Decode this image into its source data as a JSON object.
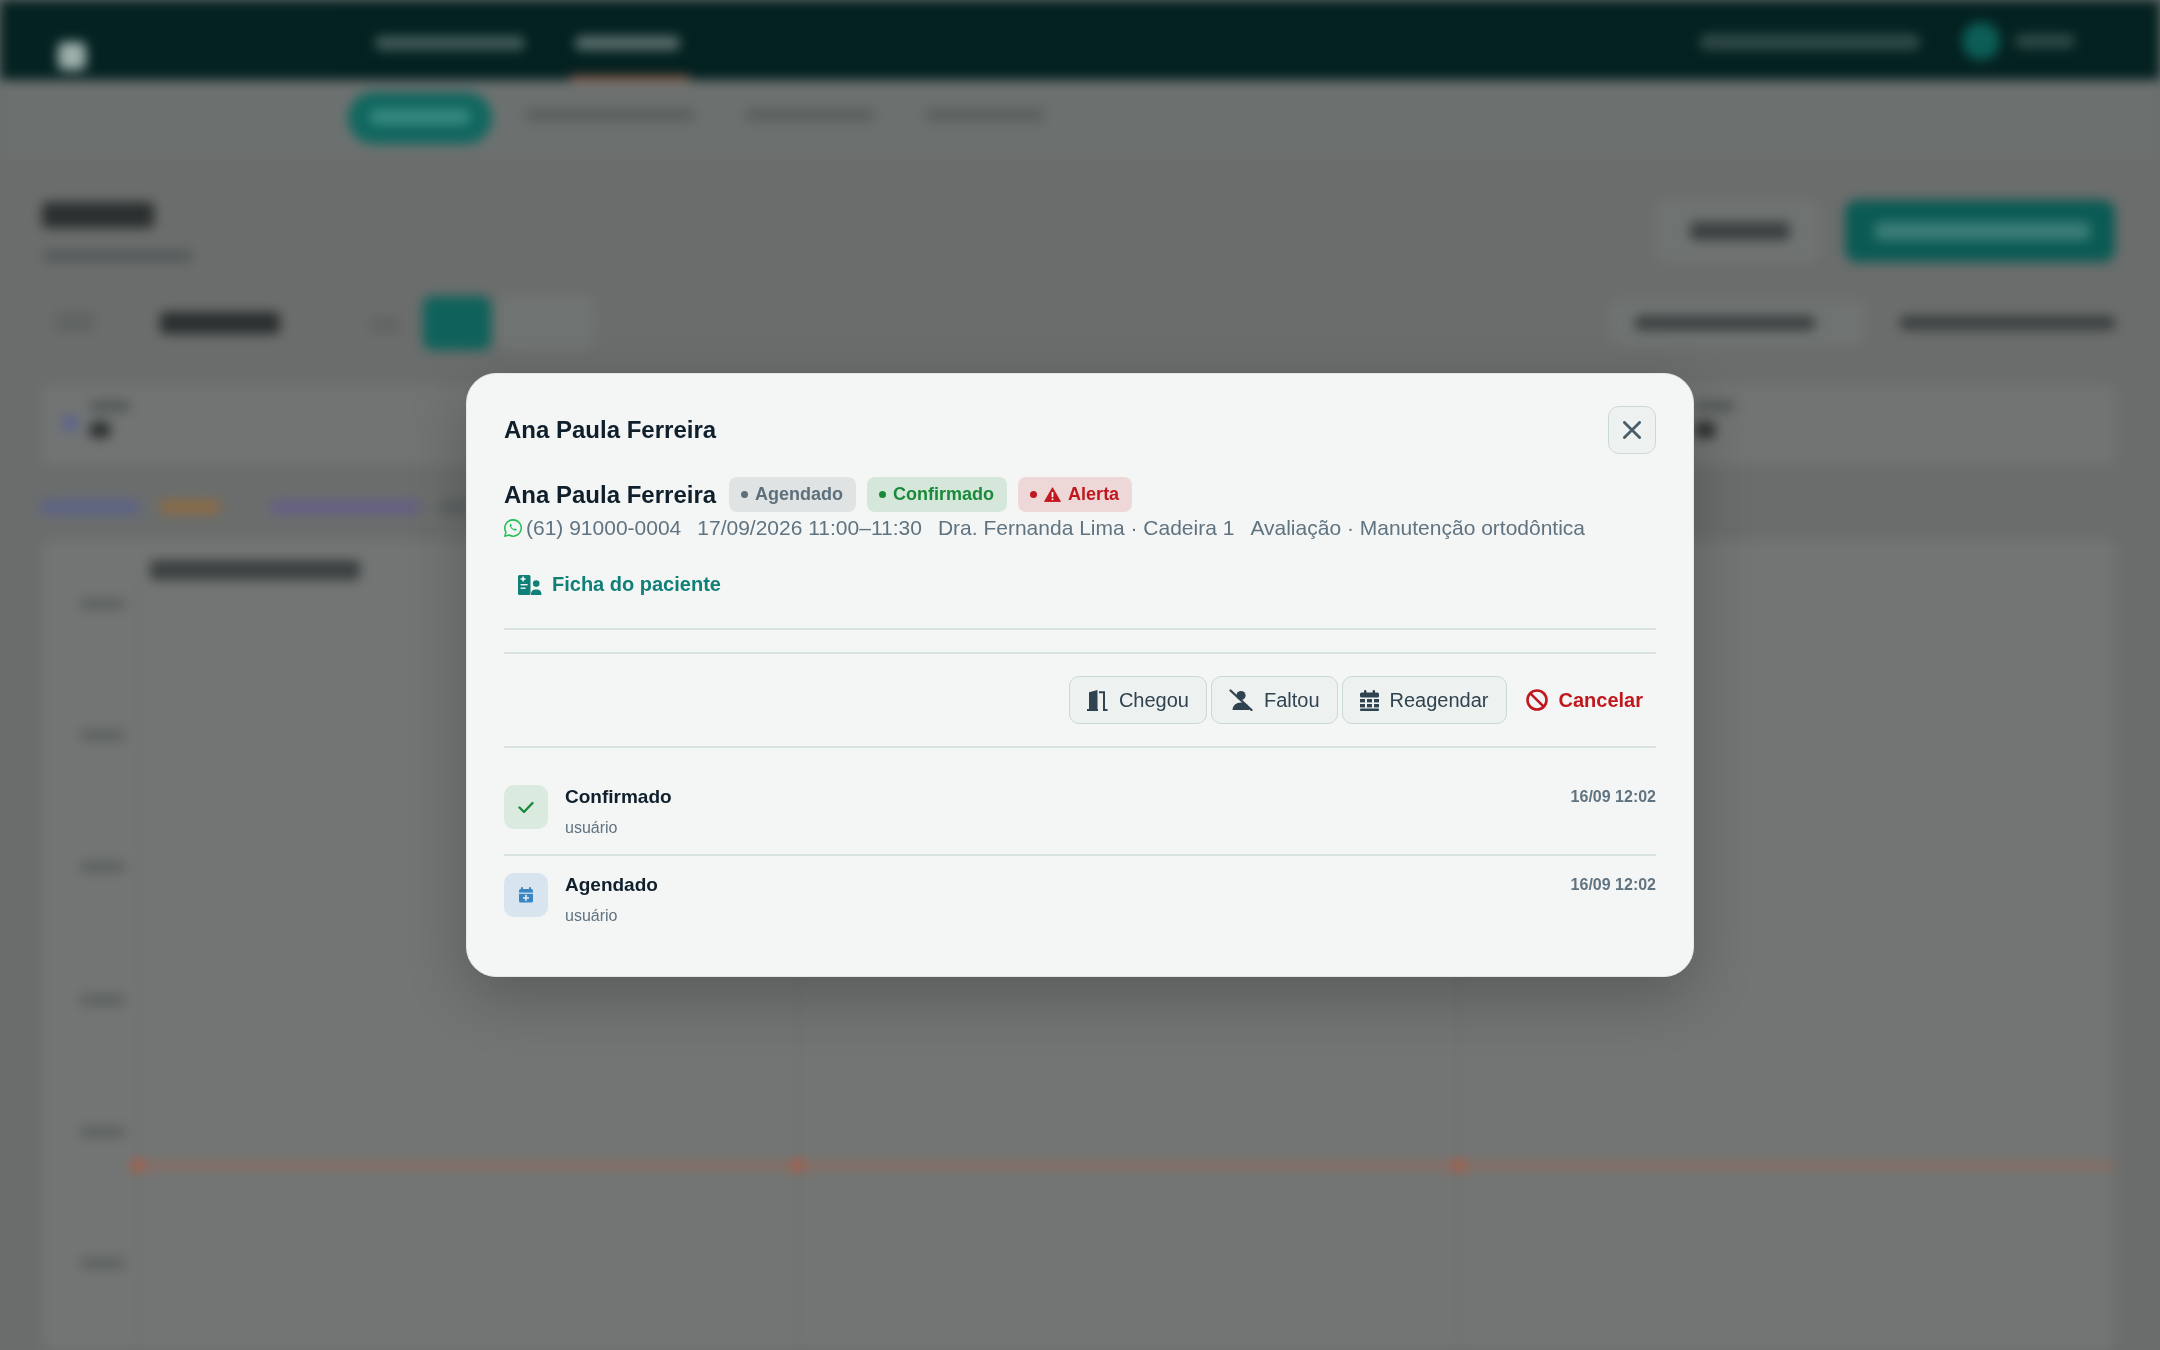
{
  "dialog": {
    "title": "Ana Paula Ferreira"
  },
  "patient": {
    "name": "Ana Paula Ferreira",
    "badges": [
      {
        "label": "Agendado",
        "kind": "status",
        "color": "#5d6f7a"
      },
      {
        "label": "Confirmado",
        "kind": "status",
        "color": "#1a8a3a"
      },
      {
        "label": "Alerta",
        "kind": "alert",
        "color": "#c0181e"
      }
    ],
    "phone": "(61) 91000-0004",
    "schedule": "17/09/2026 11:00–11:30",
    "professional": "Dra. Fernanda Lima · Cadeira 1",
    "procedure": "Avaliação · Manutenção ortodôntica"
  },
  "record_link": {
    "label": "Ficha do paciente"
  },
  "actions": [
    {
      "label": "Chegou",
      "kind": "arrived"
    },
    {
      "label": "Faltou",
      "kind": "no_show"
    },
    {
      "label": "Reagendar",
      "kind": "reschedule"
    },
    {
      "label": "Cancelar",
      "kind": "cancel"
    }
  ],
  "history": [
    {
      "status": "Confirmado",
      "author": "usuário",
      "time": "16/09 12:02",
      "kind": "confirmed"
    },
    {
      "status": "Agendado",
      "author": "usuário",
      "time": "16/09 12:02",
      "kind": "scheduled"
    }
  ]
}
